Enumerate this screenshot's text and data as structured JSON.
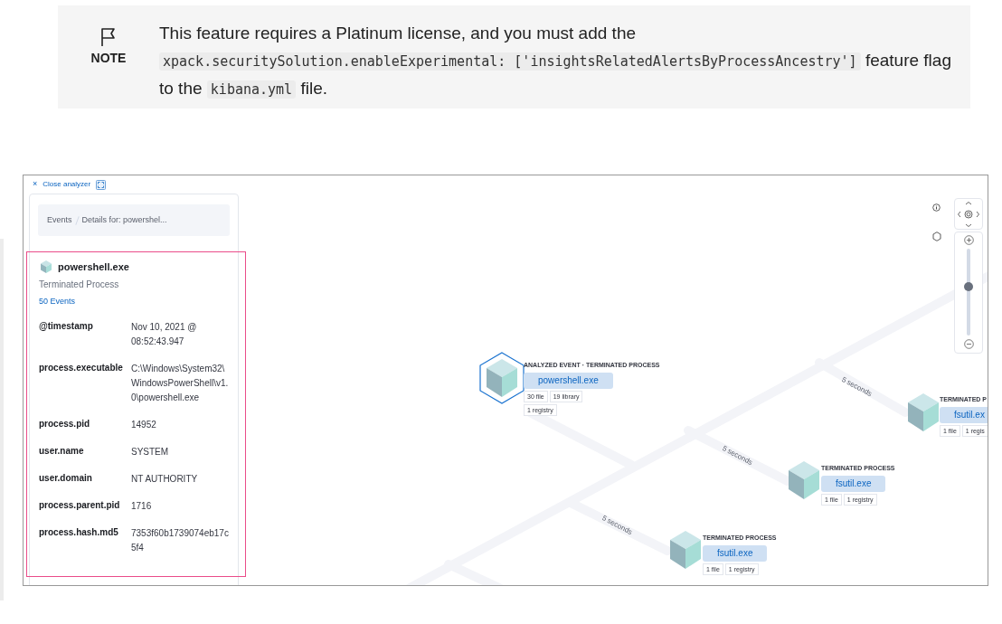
{
  "note": {
    "label": "NOTE",
    "parts": [
      {
        "kind": "text",
        "text": "This feature requires a Platinum license, and you must add the "
      },
      {
        "kind": "code",
        "text": "xpack.securitySolution.enableExperimental: ['insightsRelatedAlertsByProcessAncestry']"
      },
      {
        "kind": "text",
        "text": " feature flag to the "
      },
      {
        "kind": "code",
        "text": "kibana.yml"
      },
      {
        "kind": "text",
        "text": " file."
      }
    ]
  },
  "analyzer": {
    "close_label": "Close analyzer",
    "close_icon": "×",
    "breadcrumbs": [
      "Events",
      "Details for: powershel..."
    ],
    "process": {
      "name": "powershell.exe",
      "state": "Terminated Process",
      "events_link": "50 Events"
    },
    "fields": [
      {
        "key": "@timestamp",
        "value": "Nov 10, 2021 @ 08:52:43.947"
      },
      {
        "key": "process.executable",
        "value": "C:\\Windows\\System32\\WindowsPowerShell\\v1.0\\powershell.exe"
      },
      {
        "key": "process.pid",
        "value": "14952"
      },
      {
        "key": "user.name",
        "value": "SYSTEM"
      },
      {
        "key": "user.domain",
        "value": "NT AUTHORITY"
      },
      {
        "key": "process.parent.pid",
        "value": "1716"
      },
      {
        "key": "process.hash.md5",
        "value": "7353f60b1739074eb17c5f4"
      }
    ],
    "nodes": [
      {
        "analyzed": true,
        "title": "ANALYZED EVENT · TERMINATED PROCESS",
        "name": "powershell.exe",
        "tags": [
          "30 file",
          "19 library",
          "1 registry"
        ]
      },
      {
        "analyzed": false,
        "title": "TERMINATED PROCESS",
        "name": "fsutil.exe",
        "tags": [
          "1 file",
          "1 registry"
        ]
      },
      {
        "analyzed": false,
        "title": "TERMINATED PROCESS",
        "name": "fsutil.exe",
        "tags": [
          "1 file",
          "1 registry"
        ]
      },
      {
        "analyzed": false,
        "title": "TERMINATED P",
        "name": "fsutil.ex",
        "tags": [
          "1 file",
          "1 regis"
        ]
      }
    ],
    "edge_labels": [
      "5 seconds",
      "5 seconds",
      "5 seconds"
    ],
    "zoom": {
      "level": 0.57
    }
  }
}
